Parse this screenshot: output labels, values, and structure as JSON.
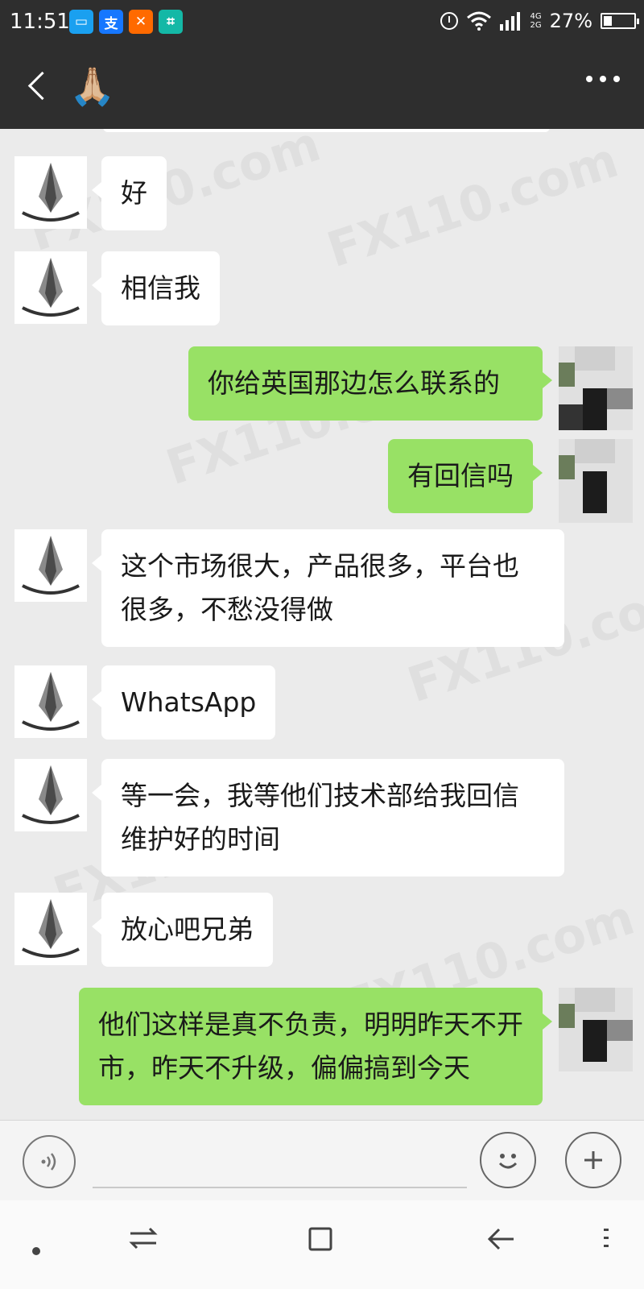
{
  "status_bar": {
    "time": "11:51",
    "app_icons": [
      "message-icon",
      "alipay-icon",
      "x-app-icon",
      "scan-app-icon"
    ],
    "app_icon_colors": [
      "#1aa0f0",
      "#1677ff",
      "#ff6a00",
      "#14b8a6"
    ],
    "app_icon_glyphs": [
      "▭",
      "支",
      "✕",
      "⌗"
    ],
    "network_top": "4G",
    "network_bottom": "2G",
    "battery": "27%",
    "battery_level": 0.27
  },
  "header": {
    "title": "🙏🏼"
  },
  "messages": [
    {
      "side": "in",
      "text": "好"
    },
    {
      "side": "in",
      "text": "相信我"
    },
    {
      "side": "out",
      "text": "你给英国那边怎么联系的"
    },
    {
      "side": "out",
      "text": "有回信吗"
    },
    {
      "side": "in",
      "text": "这个市场很大，产品很多，平台也很多，不愁没得做"
    },
    {
      "side": "in",
      "text": "WhatsApp"
    },
    {
      "side": "in",
      "text": "等一会，我等他们技术部给我回信维护好的时间"
    },
    {
      "side": "in",
      "text": "放心吧兄弟"
    },
    {
      "side": "out",
      "text": "他们这样是真不负责，明明昨天不开市，昨天不升级，偏偏搞到今天"
    }
  ],
  "watermark": "FX110.com",
  "colors": {
    "bar_dark": "#2e2e2e",
    "chat_bg": "#ebebeb",
    "bubble_out": "#98e165",
    "bubble_in": "#ffffff"
  }
}
